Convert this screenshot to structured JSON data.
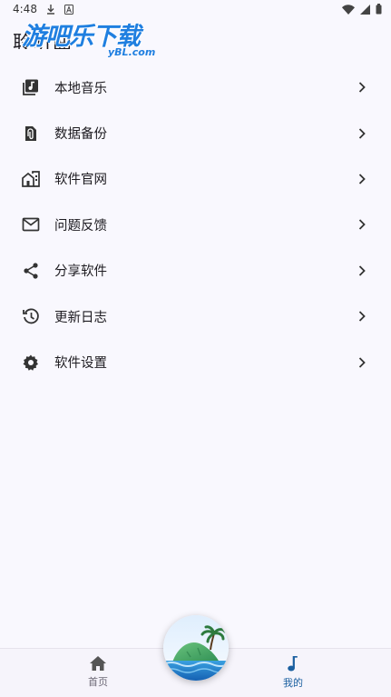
{
  "status_bar": {
    "time": "4:48",
    "icons": [
      "download-icon",
      "a-badge-icon",
      "wifi-icon",
      "signal-icon",
      "battery-icon"
    ]
  },
  "header": {
    "title": "聆听曲"
  },
  "watermark": {
    "main": "游吧乐下载",
    "sub": "yBL.com"
  },
  "menu": {
    "items": [
      {
        "label": "本地音乐",
        "icon": "local-music-icon"
      },
      {
        "label": "数据备份",
        "icon": "backup-file-icon"
      },
      {
        "label": "软件官网",
        "icon": "website-building-icon"
      },
      {
        "label": "问题反馈",
        "icon": "mail-icon"
      },
      {
        "label": "分享软件",
        "icon": "share-icon"
      },
      {
        "label": "更新日志",
        "icon": "history-icon"
      },
      {
        "label": "软件设置",
        "icon": "gear-icon"
      }
    ]
  },
  "bottom_nav": {
    "home_label": "首页",
    "mine_label": "我的",
    "active": "我的"
  },
  "colors": {
    "background": "#f9f8fe",
    "accent": "#1a5fa0",
    "text": "#1d1b20",
    "watermark": "#1f7fe0"
  }
}
